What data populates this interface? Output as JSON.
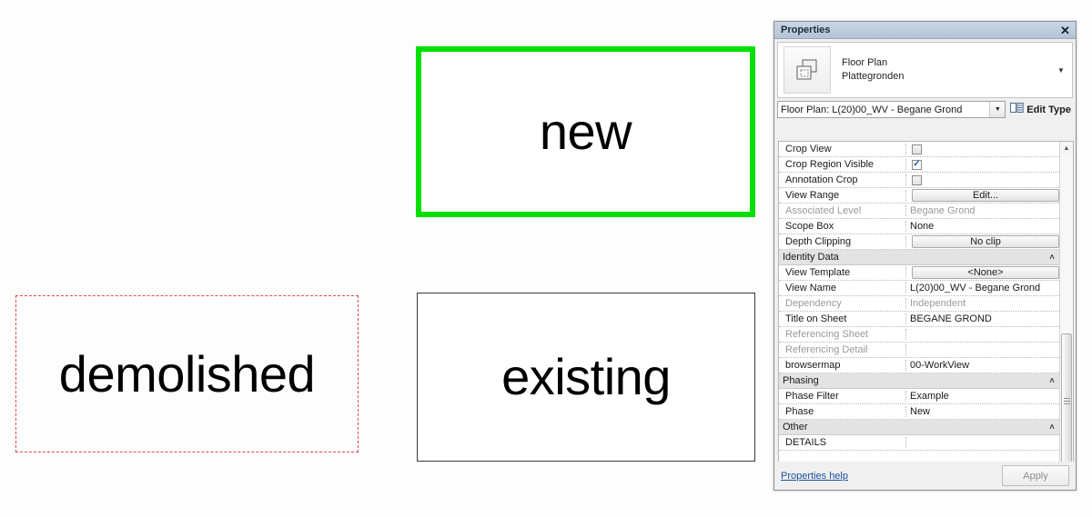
{
  "canvas": {
    "boxes": [
      {
        "key": "new",
        "label": "new",
        "style": "solid-green-thick"
      },
      {
        "key": "demolished",
        "label": "demolished",
        "style": "dashed-red-thin"
      },
      {
        "key": "existing",
        "label": "existing",
        "style": "solid-black-thin"
      }
    ],
    "new_label": "new",
    "demolished_label": "demolished",
    "existing_label": "existing"
  },
  "colors": {
    "new_border": "#00e000",
    "demolished_border": "#e04a4a",
    "existing_border": "#3a3a3a",
    "titlebar": "#bfcddc",
    "group_header": "#e3e3e3",
    "link": "#1a4fa0",
    "checkmark": "#1b5fb5"
  },
  "properties_palette": {
    "title": "Properties",
    "close_label": "✕",
    "type_category": "Floor Plan",
    "type_name": "Plattegronden",
    "type_dropdown_arrow": "▼",
    "selector_value": "Floor Plan: L(20)00_WV - Begane Grond",
    "selector_arrow": "▼",
    "edit_type_label": "Edit Type",
    "rows": [
      {
        "kind": "prop",
        "name": "Crop View",
        "value": "",
        "control": "checkbox",
        "checked": false,
        "readonly": false
      },
      {
        "kind": "prop",
        "name": "Crop Region Visible",
        "value": "",
        "control": "checkbox",
        "checked": true,
        "readonly": false
      },
      {
        "kind": "prop",
        "name": "Annotation Crop",
        "value": "",
        "control": "checkbox",
        "checked": false,
        "readonly": false
      },
      {
        "kind": "prop",
        "name": "View Range",
        "value": "Edit...",
        "control": "button",
        "readonly": false
      },
      {
        "kind": "prop",
        "name": "Associated Level",
        "value": "Begane Grond",
        "control": "text",
        "readonly": true
      },
      {
        "kind": "prop",
        "name": "Scope Box",
        "value": "None",
        "control": "text",
        "readonly": false
      },
      {
        "kind": "prop",
        "name": "Depth Clipping",
        "value": "No clip",
        "control": "button",
        "readonly": false
      },
      {
        "kind": "group",
        "name": "Identity Data",
        "collapse": "˄"
      },
      {
        "kind": "prop",
        "name": "View Template",
        "value": "<None>",
        "control": "button",
        "readonly": false
      },
      {
        "kind": "prop",
        "name": "View Name",
        "value": "L(20)00_WV - Begane Grond",
        "control": "text",
        "readonly": false
      },
      {
        "kind": "prop",
        "name": "Dependency",
        "value": "Independent",
        "control": "text",
        "readonly": true
      },
      {
        "kind": "prop",
        "name": "Title on Sheet",
        "value": "BEGANE GROND",
        "control": "text",
        "readonly": false
      },
      {
        "kind": "prop",
        "name": "Referencing Sheet",
        "value": "",
        "control": "text",
        "readonly": true
      },
      {
        "kind": "prop",
        "name": "Referencing Detail",
        "value": "",
        "control": "text",
        "readonly": true
      },
      {
        "kind": "prop",
        "name": "browsermap",
        "value": "00-WorkView",
        "control": "text",
        "readonly": false
      },
      {
        "kind": "group",
        "name": "Phasing",
        "collapse": "˄"
      },
      {
        "kind": "prop",
        "name": "Phase Filter",
        "value": "Example",
        "control": "text",
        "readonly": false
      },
      {
        "kind": "prop",
        "name": "Phase",
        "value": "New",
        "control": "text",
        "readonly": false
      },
      {
        "kind": "group",
        "name": "Other",
        "collapse": "˄"
      },
      {
        "kind": "prop",
        "name": "DETAILS",
        "value": "",
        "control": "text",
        "readonly": false
      }
    ],
    "scrollbar": {
      "up_arrow": "▲",
      "down_arrow": "▼"
    },
    "help_link": "Properties help",
    "apply_label": "Apply"
  }
}
